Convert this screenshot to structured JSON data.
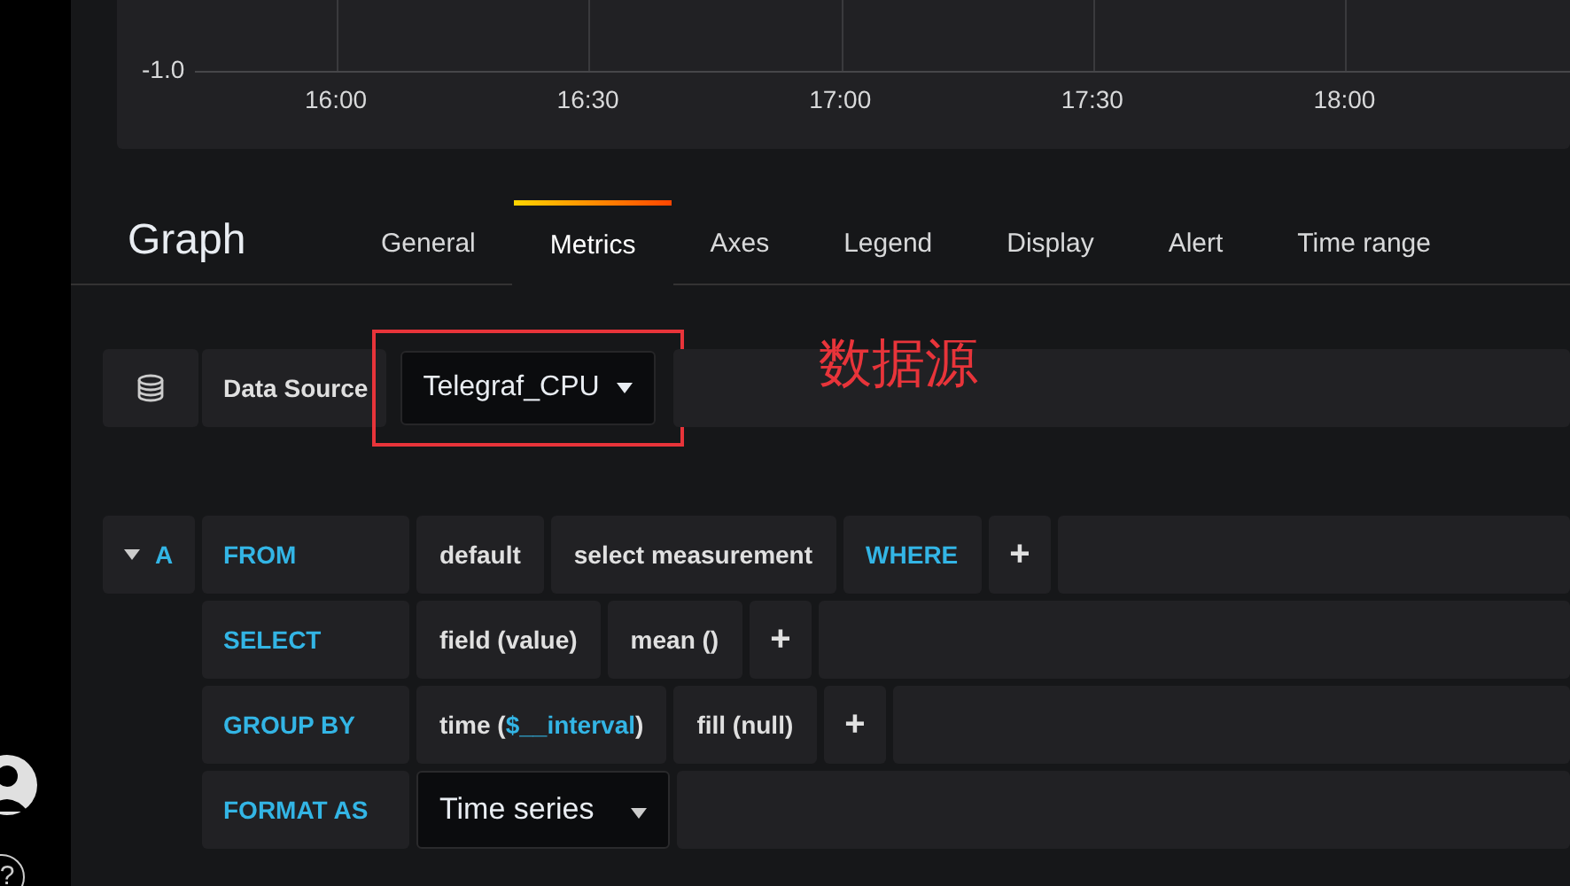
{
  "graph": {
    "y_tick": "-1.0",
    "x_ticks": [
      "16:00",
      "16:30",
      "17:00",
      "17:30",
      "18:00"
    ]
  },
  "panel": {
    "title": "Graph",
    "tabs": [
      {
        "label": "General",
        "selected": false
      },
      {
        "label": "Metrics",
        "selected": true
      },
      {
        "label": "Axes",
        "selected": false
      },
      {
        "label": "Legend",
        "selected": false
      },
      {
        "label": "Display",
        "selected": false
      },
      {
        "label": "Alert",
        "selected": false
      },
      {
        "label": "Time range",
        "selected": false
      }
    ]
  },
  "data_source": {
    "label": "Data Source",
    "value": "Telegraf_CPU",
    "annotation": "数据源"
  },
  "query": {
    "ref": "A",
    "expanded": true,
    "rows": [
      {
        "label": "FROM",
        "parts": [
          {
            "kind": "value",
            "segments": [
              {
                "text": "default",
                "accent": false
              }
            ]
          },
          {
            "kind": "value",
            "segments": [
              {
                "text": "select measurement",
                "accent": false
              }
            ]
          },
          {
            "kind": "keyword",
            "segments": [
              {
                "text": "WHERE"
              }
            ]
          },
          {
            "kind": "plus",
            "segments": [
              {
                "text": "+",
                "accent": false
              }
            ]
          }
        ]
      },
      {
        "label": "SELECT",
        "parts": [
          {
            "kind": "value",
            "segments": [
              {
                "text": "field (value)",
                "accent": false
              }
            ]
          },
          {
            "kind": "value",
            "segments": [
              {
                "text": "mean ()",
                "accent": false
              }
            ]
          },
          {
            "kind": "plus",
            "segments": [
              {
                "text": "+",
                "accent": false
              }
            ]
          }
        ]
      },
      {
        "label": "GROUP BY",
        "parts": [
          {
            "kind": "value",
            "segments": [
              {
                "text": "time (",
                "accent": false
              },
              {
                "text": "$__interval",
                "accent": true
              },
              {
                "text": ")",
                "accent": false
              }
            ]
          },
          {
            "kind": "value",
            "segments": [
              {
                "text": "fill (null)",
                "accent": false
              }
            ]
          },
          {
            "kind": "plus",
            "segments": [
              {
                "text": "+",
                "accent": false
              }
            ]
          }
        ]
      },
      {
        "label": "FORMAT AS",
        "parts": [
          {
            "kind": "select",
            "segments": [
              {
                "text": "Time series",
                "accent": false
              }
            ]
          }
        ]
      }
    ]
  },
  "sidebar": {
    "help": "?"
  }
}
